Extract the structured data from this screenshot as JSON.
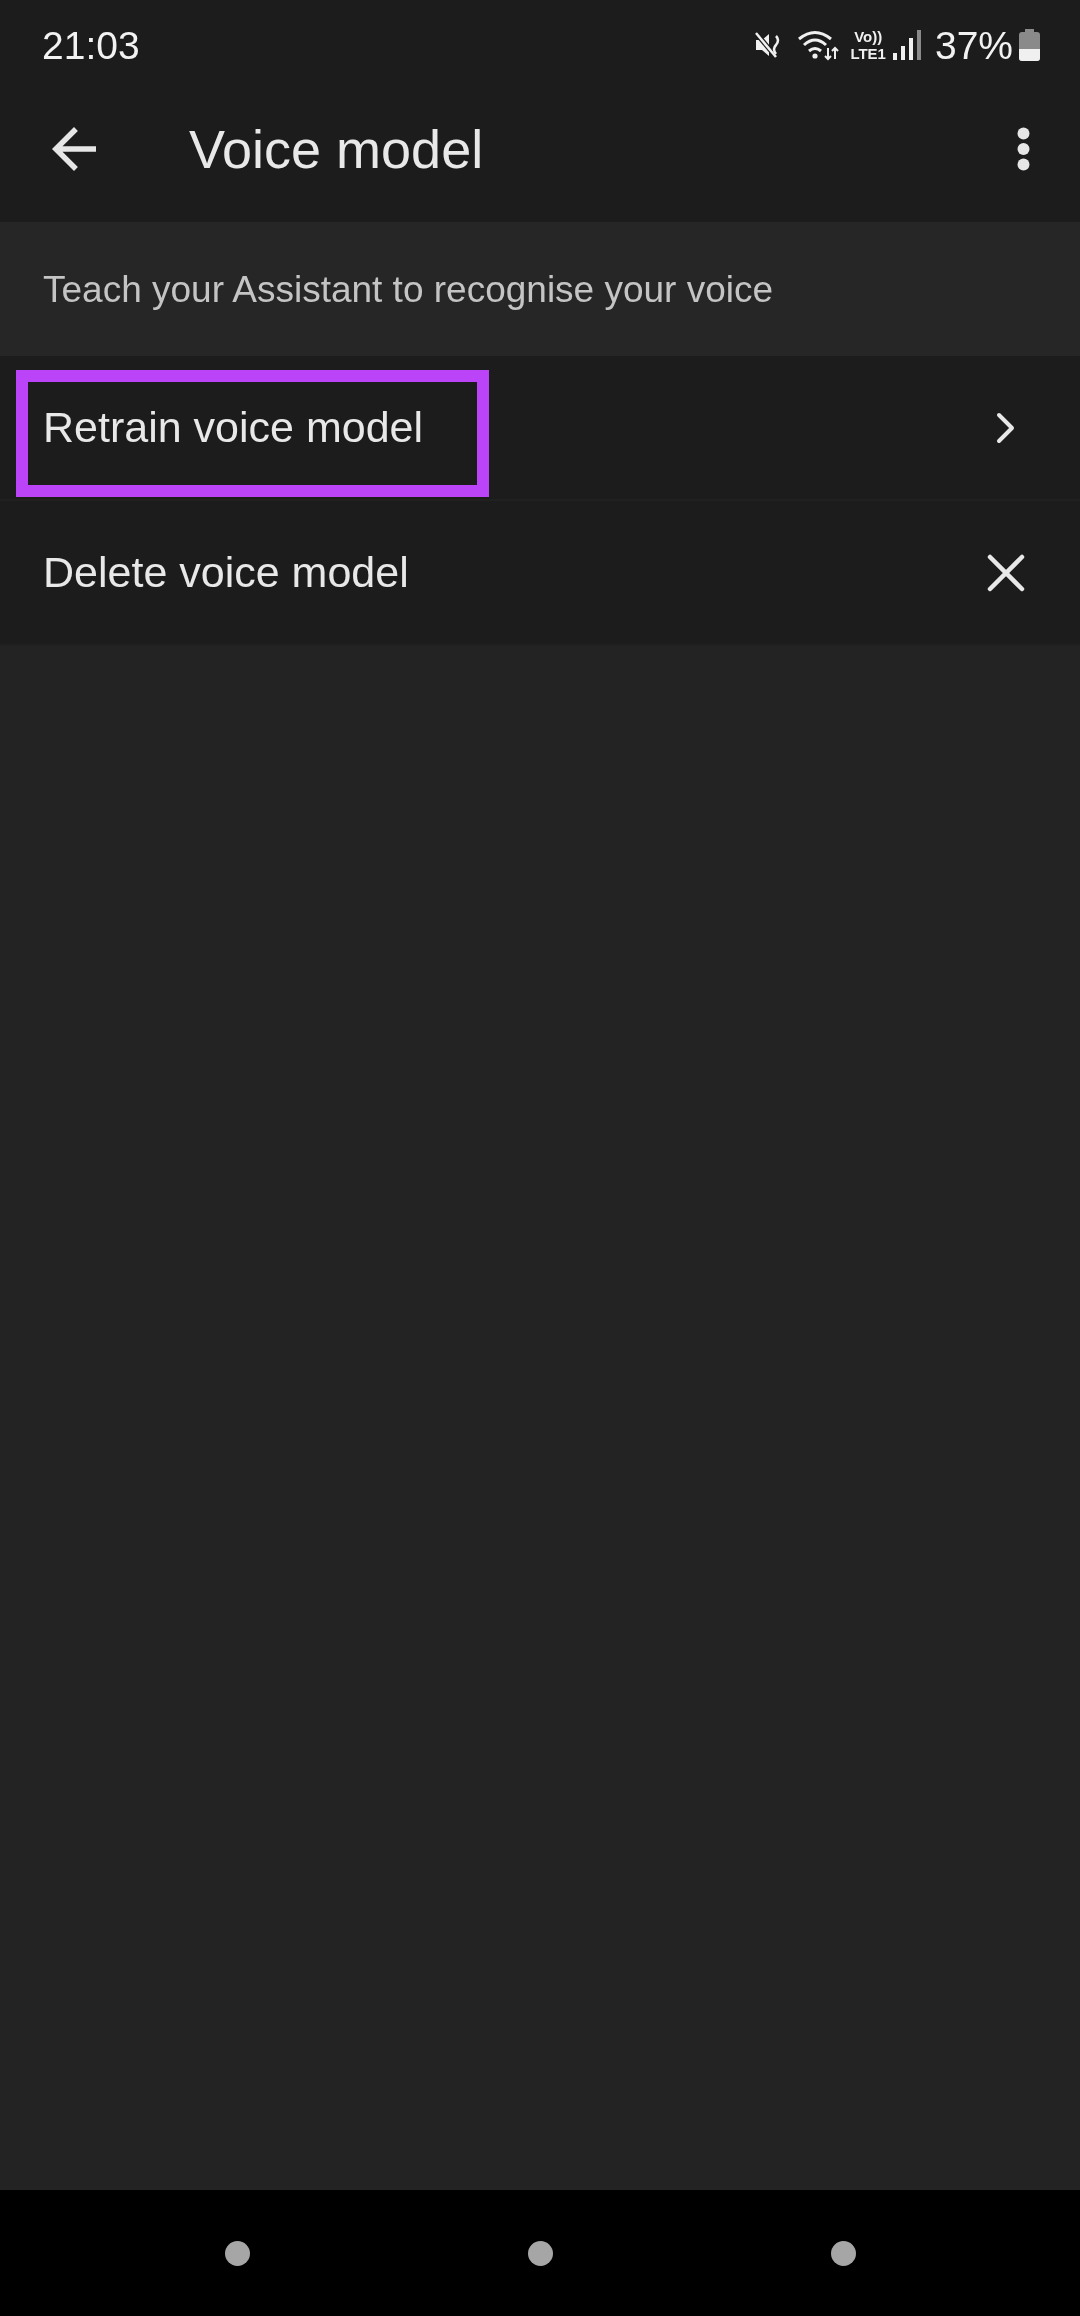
{
  "status_bar": {
    "time": "21:03",
    "volte_label": "Vo))",
    "network_label": "LTE1",
    "battery": "37%"
  },
  "app_bar": {
    "title": "Voice model"
  },
  "description": "Teach your Assistant to recognise your voice",
  "rows": [
    {
      "label": "Retrain voice model",
      "kind": "navigate",
      "highlighted": true
    },
    {
      "label": "Delete voice model",
      "kind": "remove",
      "highlighted": false
    }
  ]
}
